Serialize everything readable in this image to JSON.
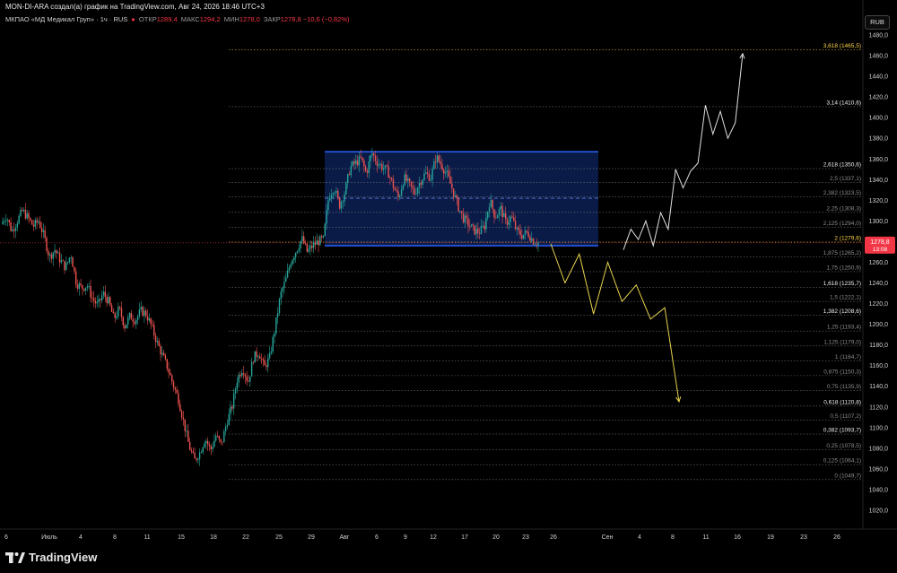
{
  "header": {
    "title": "MON-DI-ARA создал(а) график на TradingView.com, Авг 24, 2026 18:46 UTC+3"
  },
  "legend": {
    "symbol": "МКПАО «МД Медикал Груп» · 1ч · RUS",
    "open_label": "ОТКР",
    "open_value": "1289,4",
    "high_label": "МАКС",
    "high_value": "1294,2",
    "low_label": "МИН",
    "low_value": "1278,0",
    "close_label": "ЗАКР",
    "close_value": "1278,8",
    "change": "−10,6 (−0,82%)"
  },
  "currency_button": "RUB",
  "price_tag": {
    "value": "1278,8",
    "countdown": "13:08",
    "price": 1278.8,
    "color": "#f23645"
  },
  "logo": "TradingView",
  "chart_data": {
    "type": "candlestick",
    "y_ticks": [
      "1480,0",
      "1460,0",
      "1440,0",
      "1420,0",
      "1400,0",
      "1380,0",
      "1360,0",
      "1340,0",
      "1320,0",
      "1300,0",
      "1280,0",
      "1260,0",
      "1240,0",
      "1220,0",
      "1200,0",
      "1180,0",
      "1160,0",
      "1140,0",
      "1120,0",
      "1100,0",
      "1080,0",
      "1060,0",
      "1040,0",
      "1020,0"
    ],
    "y_tick_values": [
      1480,
      1460,
      1440,
      1420,
      1400,
      1380,
      1360,
      1340,
      1320,
      1300,
      1280,
      1260,
      1240,
      1220,
      1200,
      1180,
      1160,
      1140,
      1120,
      1100,
      1080,
      1060,
      1040,
      1020
    ],
    "x_ticks": [
      "6",
      "Июль",
      "4",
      "8",
      "11",
      "15",
      "18",
      "22",
      "25",
      "29",
      "Авг",
      "6",
      "9",
      "12",
      "17",
      "20",
      "23",
      "26",
      "Сен",
      "4",
      "8",
      "11",
      "16",
      "19",
      "23",
      "26"
    ],
    "price_path": [
      1297,
      1305,
      1290,
      1300,
      1310,
      1303,
      1295,
      1300,
      1285,
      1265,
      1272,
      1262,
      1255,
      1268,
      1240,
      1235,
      1238,
      1225,
      1218,
      1230,
      1222,
      1205,
      1215,
      1198,
      1208,
      1204,
      1213,
      1210,
      1198,
      1183,
      1170,
      1158,
      1142,
      1128,
      1105,
      1082,
      1068,
      1076,
      1090,
      1078,
      1092,
      1083,
      1105,
      1120,
      1148,
      1158,
      1144,
      1168,
      1173,
      1158,
      1168,
      1196,
      1228,
      1243,
      1262,
      1272,
      1283,
      1270,
      1276,
      1280,
      1282,
      1324,
      1333,
      1315,
      1328,
      1352,
      1356,
      1360,
      1346,
      1366,
      1357,
      1352,
      1348,
      1334,
      1322,
      1342,
      1335,
      1327,
      1338,
      1346,
      1342,
      1362,
      1354,
      1345,
      1331,
      1315,
      1303,
      1297,
      1291,
      1289,
      1295,
      1320,
      1304,
      1312,
      1298,
      1304,
      1290,
      1286,
      1289,
      1281,
      1278.8
    ],
    "fib_levels": [
      {
        "ratio": "0",
        "label": "0 (1049,7)",
        "price": 1049.7,
        "bold": false
      },
      {
        "ratio": "0,125",
        "label": "0,125 (1064,1)",
        "price": 1064.1,
        "bold": false
      },
      {
        "ratio": "0,25",
        "label": "0,25 (1078,5)",
        "price": 1078.5,
        "bold": false
      },
      {
        "ratio": "0,382",
        "label": "0,382 (1093,7)",
        "price": 1093.7,
        "bold": true
      },
      {
        "ratio": "0,5",
        "label": "0,5 (1107,2)",
        "price": 1107.2,
        "bold": false
      },
      {
        "ratio": "0,618",
        "label": "0,618 (1120,8)",
        "price": 1120.8,
        "bold": true
      },
      {
        "ratio": "0,75",
        "label": "0,75 (1135,9)",
        "price": 1135.9,
        "bold": false
      },
      {
        "ratio": "0,875",
        "label": "0,875 (1150,3)",
        "price": 1150.3,
        "bold": false
      },
      {
        "ratio": "1",
        "label": "1 (1164,7)",
        "price": 1164.7,
        "bold": false
      },
      {
        "ratio": "1,125",
        "label": "1,125 (1179,0)",
        "price": 1179.0,
        "bold": false
      },
      {
        "ratio": "1,25",
        "label": "1,25 (1193,4)",
        "price": 1193.4,
        "bold": false
      },
      {
        "ratio": "1,382",
        "label": "1,382 (1208,6)",
        "price": 1208.6,
        "bold": true
      },
      {
        "ratio": "1,5",
        "label": "1,5 (1222,1)",
        "price": 1222.1,
        "bold": false
      },
      {
        "ratio": "1,618",
        "label": "1,618 (1235,7)",
        "price": 1235.7,
        "bold": true
      },
      {
        "ratio": "1,75",
        "label": "1,75 (1250,9)",
        "price": 1250.9,
        "bold": false
      },
      {
        "ratio": "1,875",
        "label": "1,875 (1265,2)",
        "price": 1265.2,
        "bold": false
      },
      {
        "ratio": "2",
        "label": "2 (1279,6)",
        "price": 1279.6,
        "bold": false,
        "color": "#ffd54f"
      },
      {
        "ratio": "2,125",
        "label": "2,125 (1294,0)",
        "price": 1294.0,
        "bold": false
      },
      {
        "ratio": "2,25",
        "label": "2,25 (1308,3)",
        "price": 1308.3,
        "bold": false
      },
      {
        "ratio": "2,382",
        "label": "2,382 (1323,5)",
        "price": 1323.5,
        "bold": false
      },
      {
        "ratio": "2,5",
        "label": "2,5 (1337,1)",
        "price": 1337.1,
        "bold": false
      },
      {
        "ratio": "2,618",
        "label": "2,618 (1350,6)",
        "price": 1350.6,
        "bold": true
      },
      {
        "ratio": "3,14",
        "label": "3,14 (1410,6)",
        "price": 1410.6,
        "bold": true
      },
      {
        "ratio": "3,618",
        "label": "3,618 (1465,5)",
        "price": 1465.5,
        "bold": true,
        "color": "#ffd54f"
      }
    ],
    "range_box": {
      "top_price": 1367,
      "bottom_price": 1276,
      "mid_price": 1322,
      "color": "#2962ff"
    },
    "bearish_projection": [
      1278,
      1240,
      1268,
      1210,
      1260,
      1222,
      1238,
      1205,
      1216,
      1125
    ],
    "bullish_projection": [
      1272,
      1292,
      1282,
      1300,
      1276,
      1308,
      1292,
      1350,
      1332,
      1348,
      1356,
      1412,
      1384,
      1406,
      1380,
      1395,
      1462
    ],
    "colors": {
      "up": "#26a69a",
      "down": "#ef5350",
      "bearish": "#e8d44d",
      "bullish": "#e0e0e0",
      "fib": "#8a8a8a"
    }
  }
}
